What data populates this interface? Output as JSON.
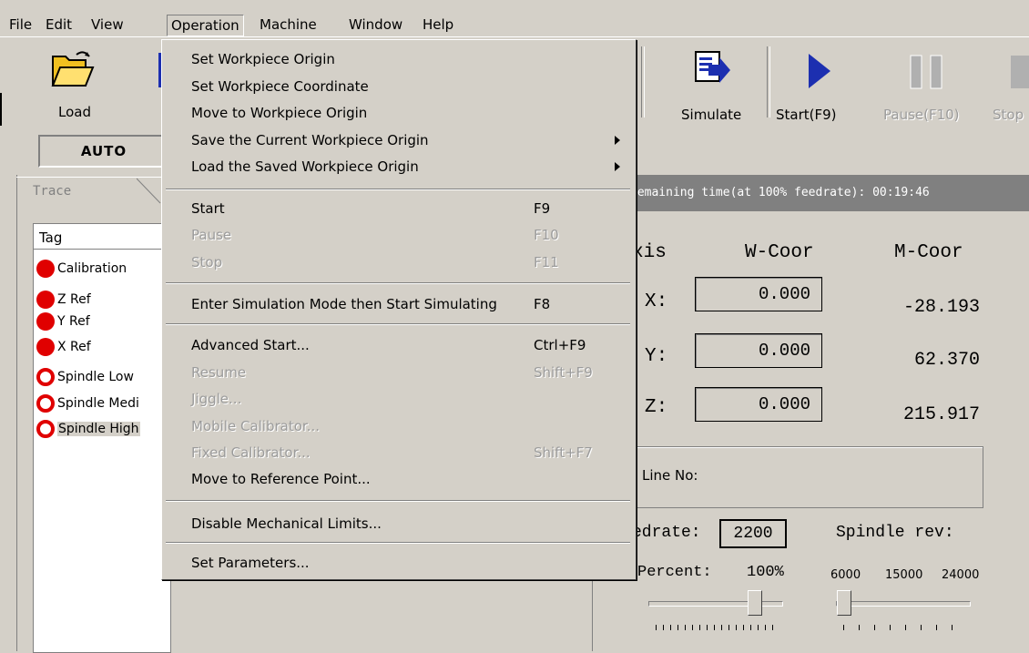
{
  "menubar": {
    "items": [
      "File",
      "Edit",
      "View",
      "Operation",
      "Machine",
      "Window",
      "Help"
    ],
    "active": "Operation"
  },
  "toolbar": {
    "load_label": "Load",
    "simulate_label": "Simulate",
    "start_label": "Start(F9)",
    "pause_label": "Pause(F10)",
    "stop_label": "Stop"
  },
  "mode": {
    "label": "AUTO"
  },
  "trace_tab": {
    "label": "Trace"
  },
  "tag_list": {
    "header": "Tag",
    "items": [
      {
        "label": "Calibration",
        "state": "active"
      },
      {
        "label": "Z Ref",
        "state": "active"
      },
      {
        "label": "Y Ref",
        "state": "active"
      },
      {
        "label": "X Ref",
        "state": "active"
      },
      {
        "label": "Spindle Low",
        "state": "inactive"
      },
      {
        "label": "Spindle Medi",
        "state": "inactive"
      },
      {
        "label": "Spindle High",
        "state": "inactive"
      }
    ]
  },
  "menu": {
    "items": [
      {
        "label": "Set Workpiece Origin",
        "shortcut": "",
        "disabled": false,
        "submenu": false
      },
      {
        "label": "Set Workpiece Coordinate",
        "shortcut": "",
        "disabled": false,
        "submenu": false
      },
      {
        "label": "Move to Workpiece Origin",
        "shortcut": "",
        "disabled": false,
        "submenu": false
      },
      {
        "label": "Save the Current Workpiece Origin",
        "shortcut": "",
        "disabled": false,
        "submenu": true
      },
      {
        "label": "Load the Saved Workpiece Origin",
        "shortcut": "",
        "disabled": false,
        "submenu": true
      },
      {
        "label": "Start",
        "shortcut": "F9",
        "disabled": false,
        "submenu": false
      },
      {
        "label": "Pause",
        "shortcut": "F10",
        "disabled": true,
        "submenu": false
      },
      {
        "label": "Stop",
        "shortcut": "F11",
        "disabled": true,
        "submenu": false
      },
      {
        "label": "Enter Simulation Mode then Start Simulating",
        "shortcut": "F8",
        "disabled": false,
        "submenu": false
      },
      {
        "label": "Advanced Start...",
        "shortcut": "Ctrl+F9",
        "disabled": false,
        "submenu": false
      },
      {
        "label": "Resume",
        "shortcut": "Shift+F9",
        "disabled": true,
        "submenu": false
      },
      {
        "label": "Jiggle...",
        "shortcut": "",
        "disabled": true,
        "submenu": false
      },
      {
        "label": "Mobile Calibrator...",
        "shortcut": "",
        "disabled": true,
        "submenu": false
      },
      {
        "label": "Fixed Calibrator...",
        "shortcut": "Shift+F7",
        "disabled": true,
        "submenu": false
      },
      {
        "label": "Move to Reference Point...",
        "shortcut": "",
        "disabled": false,
        "submenu": false
      },
      {
        "label": "Disable Mechanical Limits...",
        "shortcut": "",
        "disabled": false,
        "submenu": false
      },
      {
        "label": "Set Parameters...",
        "shortcut": "",
        "disabled": false,
        "submenu": false
      }
    ]
  },
  "status": {
    "text": "Remaining time(at 100% feedrate): 00:19:46"
  },
  "coords": {
    "axis_header": "xis",
    "w_header": "W-Coor",
    "m_header": "M-Coor",
    "rows": [
      {
        "axis": "X:",
        "w": "0.000",
        "m": "-28.193"
      },
      {
        "axis": "Y:",
        "w": "0.000",
        "m": "62.370"
      },
      {
        "axis": "Z:",
        "w": "0.000",
        "m": "215.917"
      }
    ]
  },
  "line_no": {
    "label": "Line No:"
  },
  "feed": {
    "label": "edrate:",
    "value": "2200",
    "spindle_label": "Spindle rev:",
    "percent_label": "Percent:",
    "percent_value": "100%",
    "spindle_ticks": [
      "6000",
      "15000",
      "24000"
    ]
  }
}
